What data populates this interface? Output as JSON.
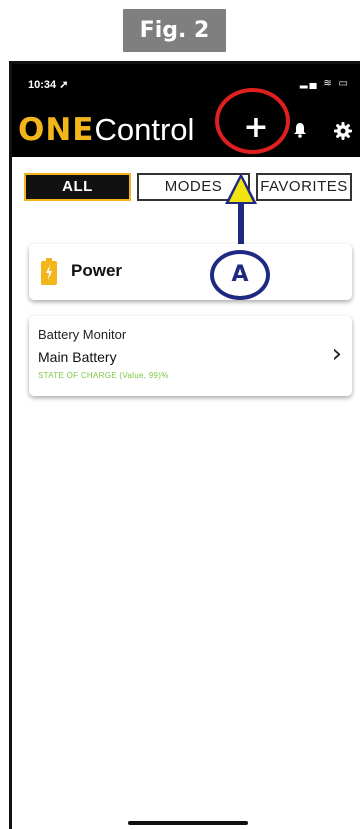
{
  "figure": {
    "label": "Fig. 2"
  },
  "status_bar": {
    "time": "10:34 ➚",
    "indicators": "▂▄ ≋ ▭"
  },
  "app": {
    "logo_bold": "ONE",
    "logo_light": "Control",
    "add_symbol": "+"
  },
  "tabs": [
    {
      "label": "ALL",
      "selected": true
    },
    {
      "label": "MODES",
      "selected": false
    },
    {
      "label": "FAVORITES",
      "selected": false
    }
  ],
  "callout": {
    "label": "A"
  },
  "section": {
    "title": "Power"
  },
  "device": {
    "type": "Battery Monitor",
    "name": "Main Battery",
    "status": "STATE OF CHARGE (Value, 99)%",
    "chevron": "›"
  },
  "colors": {
    "brand_yellow": "#f2b51c",
    "highlight_red": "#e02020",
    "callout_blue": "#1d2a80",
    "status_green": "#7ac943"
  },
  "icons": [
    "plus-icon",
    "bell-icon",
    "gear-icon",
    "battery-icon",
    "chevron-right-icon"
  ]
}
